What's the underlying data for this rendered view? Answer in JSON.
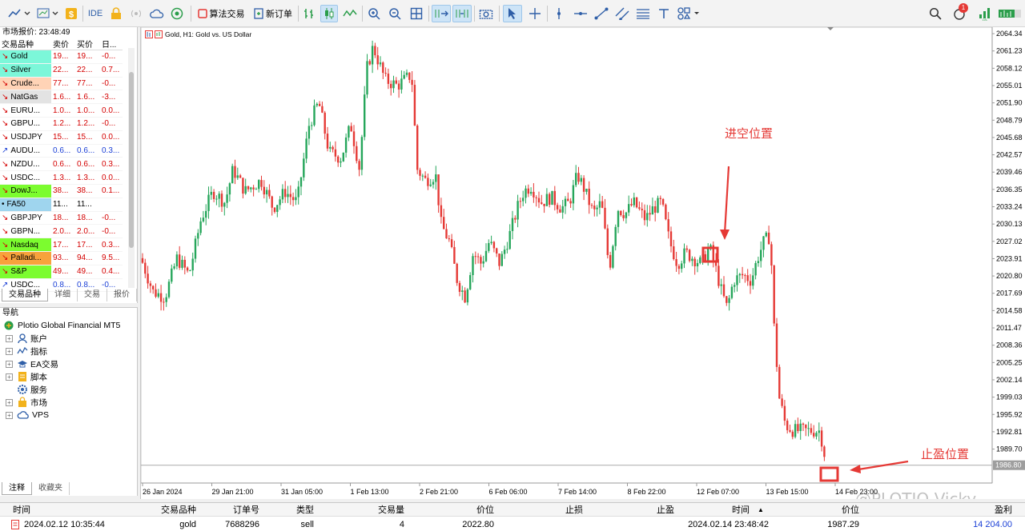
{
  "toolbar": {
    "ide_label": "IDE",
    "algo_trading_label": "算法交易",
    "new_order_label": "新订单",
    "notification_count": "1"
  },
  "market_watch": {
    "title": "市场报价: 23:48:49",
    "columns": [
      "交易品种",
      "卖价",
      "买价",
      "日..."
    ],
    "rows": [
      {
        "symbol": "Gold",
        "bid": "19...",
        "ask": "19...",
        "change": "-0...",
        "dir": "↘",
        "bg": "#7cf7d9",
        "color": "#d40000"
      },
      {
        "symbol": "Silver",
        "bid": "22...",
        "ask": "22...",
        "change": "0.7...",
        "dir": "↘",
        "bg": "#7cf7d9",
        "color": "#d40000"
      },
      {
        "symbol": "Crude...",
        "bid": "77...",
        "ask": "77...",
        "change": "-0...",
        "dir": "↘",
        "bg": "#ffd3b6",
        "color": "#d40000"
      },
      {
        "symbol": "NatGas",
        "bid": "1.6...",
        "ask": "1.6...",
        "change": "-3...",
        "dir": "↘",
        "bg": "#e3e3e3",
        "color": "#d40000"
      },
      {
        "symbol": "EURU...",
        "bid": "1.0...",
        "ask": "1.0...",
        "change": "0.0...",
        "dir": "↘",
        "bg": "#ffffff",
        "color": "#d40000"
      },
      {
        "symbol": "GBPU...",
        "bid": "1.2...",
        "ask": "1.2...",
        "change": "-0...",
        "dir": "↘",
        "bg": "#ffffff",
        "color": "#d40000"
      },
      {
        "symbol": "USDJPY",
        "bid": "15...",
        "ask": "15...",
        "change": "0.0...",
        "dir": "↘",
        "bg": "#ffffff",
        "color": "#d40000"
      },
      {
        "symbol": "AUDU...",
        "bid": "0.6...",
        "ask": "0.6...",
        "change": "0.3...",
        "dir": "↗",
        "bg": "#ffffff",
        "color": "#1a3fd6"
      },
      {
        "symbol": "NZDU...",
        "bid": "0.6...",
        "ask": "0.6...",
        "change": "0.3...",
        "dir": "↘",
        "bg": "#ffffff",
        "color": "#d40000"
      },
      {
        "symbol": "USDC...",
        "bid": "1.3...",
        "ask": "1.3...",
        "change": "0.0...",
        "dir": "↘",
        "bg": "#ffffff",
        "color": "#d40000"
      },
      {
        "symbol": "DowJ...",
        "bid": "38...",
        "ask": "38...",
        "change": "0.1...",
        "dir": "↘",
        "bg": "#7cfc2f",
        "color": "#d40000"
      },
      {
        "symbol": "FA50",
        "bid": "11...",
        "ask": "11...",
        "change": "",
        "dir": "•",
        "bg": "#9fd5ee",
        "color": "#000000"
      },
      {
        "symbol": "GBPJPY",
        "bid": "18...",
        "ask": "18...",
        "change": "-0...",
        "dir": "↘",
        "bg": "#ffffff",
        "color": "#d40000"
      },
      {
        "symbol": "GBPN...",
        "bid": "2.0...",
        "ask": "2.0...",
        "change": "-0...",
        "dir": "↘",
        "bg": "#ffffff",
        "color": "#d40000"
      },
      {
        "symbol": "Nasdaq",
        "bid": "17...",
        "ask": "17...",
        "change": "0.3...",
        "dir": "↘",
        "bg": "#7cfc2f",
        "color": "#d40000"
      },
      {
        "symbol": "Palladi...",
        "bid": "93...",
        "ask": "94...",
        "change": "9.5...",
        "dir": "↘",
        "bg": "#f7a23c",
        "color": "#d40000"
      },
      {
        "symbol": "S&P",
        "bid": "49...",
        "ask": "49...",
        "change": "0.4...",
        "dir": "↘",
        "bg": "#7cfc2f",
        "color": "#d40000"
      },
      {
        "symbol": "USDC...",
        "bid": "0.8...",
        "ask": "0.8...",
        "change": "-0...",
        "dir": "↗",
        "bg": "#ffffff",
        "color": "#1a3fd6"
      }
    ],
    "tabs": [
      "交易品种",
      "详细",
      "交易",
      "报价"
    ]
  },
  "navigator": {
    "title": "导航",
    "root": "Plotio Global Financial MT5",
    "items": [
      "账户",
      "指标",
      "EA交易",
      "脚本",
      "服务",
      "市场",
      "VPS"
    ],
    "tabs": [
      "注释",
      "收藏夹"
    ]
  },
  "chart": {
    "title": "Gold, H1:  Gold vs. US Dollar",
    "price_labels": [
      "2064.34",
      "2061.23",
      "2058.12",
      "2055.01",
      "2051.90",
      "2048.79",
      "2045.68",
      "2042.57",
      "2039.46",
      "2036.35",
      "2033.24",
      "2030.13",
      "2027.02",
      "2023.91",
      "2020.80",
      "2017.69",
      "2014.58",
      "2011.47",
      "2008.36",
      "2005.25",
      "2002.14",
      "1999.03",
      "1995.92",
      "1992.81",
      "1989.70"
    ],
    "current_price": "1986.80",
    "time_labels": [
      "26 Jan 2024",
      "29 Jan 21:00",
      "31 Jan 05:00",
      "1 Feb 13:00",
      "2 Feb 21:00",
      "6 Feb 06:00",
      "7 Feb 14:00",
      "8 Feb 22:00",
      "12 Feb 07:00",
      "13 Feb 15:00",
      "14 Feb 23:00"
    ],
    "annotation_entry": "进空位置",
    "annotation_tp": "止盈位置",
    "watermark": "@PLOTIO-Vicky",
    "up_color": "#26a65b",
    "down_color": "#e53935",
    "annotation_color": "#e53935"
  },
  "trades": {
    "headers": {
      "time": "时间",
      "symbol": "交易品种",
      "ticket": "订单号",
      "type": "类型",
      "volume": "交易量",
      "price": "价位",
      "sl": "止损",
      "tp": "止盈",
      "close_time": "时间",
      "close_price": "价位",
      "profit": "盈利"
    },
    "row": {
      "time": "2024.02.12 10:35:44",
      "symbol": "gold",
      "ticket": "7688296",
      "type": "sell",
      "volume": "4",
      "price": "2022.80",
      "sl": "",
      "tp": "",
      "close_time": "2024.02.14 23:48:42",
      "close_price": "1987.29",
      "profit": "14 204.00"
    }
  }
}
